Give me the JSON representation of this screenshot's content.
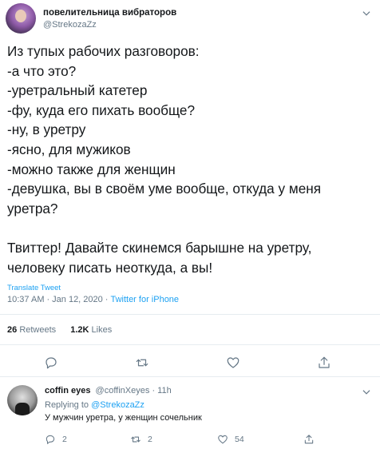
{
  "author": {
    "display_name": "повелительница вибраторов",
    "handle": "@StrekozaZz"
  },
  "tweet": {
    "lines": [
      "Из тупых рабочих разговоров:",
      "-а что это?",
      "-уретральный катетер",
      "-фу, куда его пихать вообще?",
      "-ну, в уретру",
      "-ясно, для мужиков",
      "-можно также для женщин",
      "-девушка, вы в своём уме вообще, откуда у меня",
      "уретра?",
      "Твиттер! Давайте скинемся барышне на уретру,",
      "человеку писать неоткуда, а вы!"
    ],
    "translate_label": "Translate Tweet",
    "time": "10:37 AM",
    "date": "Jan 12, 2020",
    "source": "Twitter for iPhone",
    "retweets_count": "26",
    "retweets_label": "Retweets",
    "likes_count": "1.2K",
    "likes_label": "Likes"
  },
  "reply": {
    "display_name": "coffin eyes",
    "handle": "@coffinXeyes",
    "time": "11h",
    "replying_prefix": "Replying to",
    "replying_to": "@StrekozaZz",
    "text": "У мужчин уретра, у женщин сочельник",
    "reply_count": "2",
    "retweet_count": "2",
    "like_count": "54"
  },
  "icons": {
    "reply": "reply-icon",
    "retweet": "retweet-icon",
    "like": "heart-icon",
    "share": "share-icon",
    "more": "chevron-down-icon"
  },
  "colors": {
    "accent": "#1da1f2",
    "secondary_text": "#657786",
    "divider": "#e6ecf0"
  }
}
